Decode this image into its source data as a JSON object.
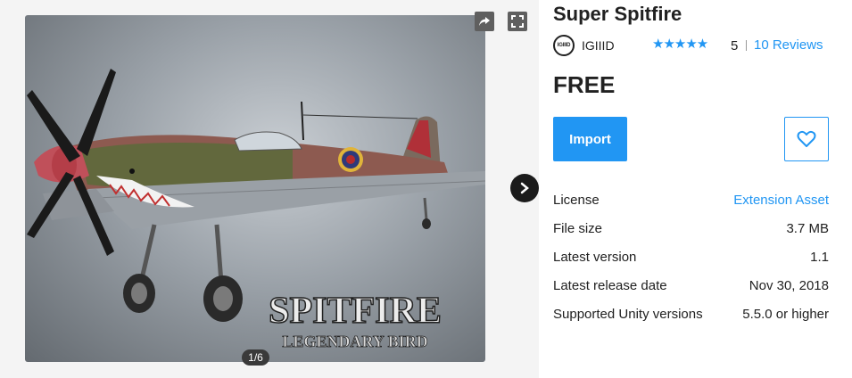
{
  "gallery": {
    "image_alt": "Super Spitfire airplane model",
    "overlay_title": "SPITFIRE",
    "overlay_subtitle": "LEGENDARY BIRD",
    "counter": "1/6",
    "share_icon": "share-icon",
    "fullscreen_icon": "fullscreen-icon",
    "next_icon": "chevron-right-icon"
  },
  "product": {
    "title": "Super Spitfire",
    "publisher_logo_text": "IGIIID",
    "publisher": "IGIIID",
    "stars": "★★★★★",
    "rating": "5",
    "reviews": "10 Reviews",
    "price": "FREE",
    "import_label": "Import",
    "favorite_icon": "heart-icon"
  },
  "details": [
    {
      "label": "License",
      "value": "Extension Asset",
      "link": true
    },
    {
      "label": "File size",
      "value": "3.7 MB",
      "link": false
    },
    {
      "label": "Latest version",
      "value": "1.1",
      "link": false
    },
    {
      "label": "Latest release date",
      "value": "Nov 30, 2018",
      "link": false
    },
    {
      "label": "Supported Unity versions",
      "value": "5.5.0 or higher",
      "link": false
    }
  ],
  "colors": {
    "accent": "#2196f3",
    "text": "#212121",
    "gallery_bg": "#f4f4f4"
  }
}
